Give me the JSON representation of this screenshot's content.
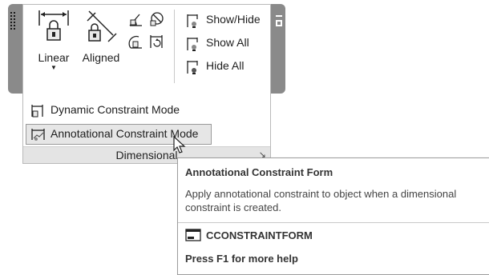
{
  "ribbon": {
    "linear_label": "Linear",
    "aligned_label": "Aligned",
    "show_hide_label": "Show/Hide",
    "show_all_label": "Show All",
    "hide_all_label": "Hide All",
    "dynamic_mode_label": "Dynamic Constraint Mode",
    "annotational_mode_label": "Annotational Constraint Mode",
    "panel_title": "Dimensional",
    "launcher_glyph": "↘"
  },
  "tooltip": {
    "title": "Annotational Constraint Form",
    "description": "Apply annotational constraint to object when a dimensional constraint is created.",
    "command": "CCONSTRAINTFORM",
    "help": "Press F1 for more help"
  },
  "icons": [
    "linear-constraint-icon",
    "aligned-constraint-icon",
    "angular-constraint-icon",
    "radial-constraint-icon",
    "diameter-constraint-icon",
    "convert-constraint-icon",
    "show-hide-icon",
    "show-all-icon",
    "hide-all-icon",
    "dynamic-mode-icon",
    "annotational-mode-icon",
    "command-icon",
    "mouse-cursor-icon"
  ]
}
